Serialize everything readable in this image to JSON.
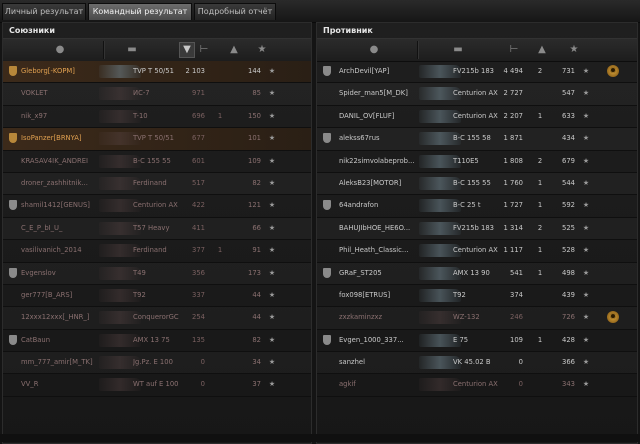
{
  "tabs": [
    {
      "label": "Личный результат",
      "active": false
    },
    {
      "label": "Командный результат",
      "active": true
    },
    {
      "label": "Подробный отчёт",
      "active": false
    }
  ],
  "allies": {
    "title": "Союзники",
    "rows": [
      {
        "name": "Gleborg[-KOPM]",
        "tank": "TVP T 50/51",
        "dmg": "2 103",
        "kills": "",
        "pts": "144",
        "hl": true,
        "dead": false
      },
      {
        "name": "VOKLET",
        "tank": "ИС-7",
        "dmg": "971",
        "kills": "",
        "pts": "85",
        "hl": false,
        "dead": true
      },
      {
        "name": "nik_x97",
        "tank": "T-10",
        "dmg": "696",
        "kills": "1",
        "pts": "150",
        "hl": false,
        "dead": true
      },
      {
        "name": "IsoPanzer[BRNYA]",
        "tank": "TVP T 50/51",
        "dmg": "677",
        "kills": "",
        "pts": "101",
        "hl": true,
        "dead": true
      },
      {
        "name": "KRASAV4IK_ANDREI",
        "tank": "B-C 155 55",
        "dmg": "601",
        "kills": "",
        "pts": "109",
        "hl": false,
        "dead": true
      },
      {
        "name": "droner_zashhitnik...",
        "tank": "Ferdinand",
        "dmg": "517",
        "kills": "",
        "pts": "82",
        "hl": false,
        "dead": true
      },
      {
        "name": "shamil1412[GENUS]",
        "tank": "Centurion AX",
        "dmg": "422",
        "kills": "",
        "pts": "121",
        "hl": false,
        "dead": true
      },
      {
        "name": "C_E_P_bI_U_",
        "tank": "T57 Heavy",
        "dmg": "411",
        "kills": "",
        "pts": "66",
        "hl": false,
        "dead": true
      },
      {
        "name": "vasilivanich_2014",
        "tank": "Ferdinand",
        "dmg": "377",
        "kills": "1",
        "pts": "91",
        "hl": false,
        "dead": true
      },
      {
        "name": "Evgenslov",
        "tank": "T49",
        "dmg": "356",
        "kills": "",
        "pts": "173",
        "hl": false,
        "dead": true
      },
      {
        "name": "ger777[B_ARS]",
        "tank": "T92",
        "dmg": "337",
        "kills": "",
        "pts": "44",
        "hl": false,
        "dead": true
      },
      {
        "name": "12xxx12xxx[_HNR_]",
        "tank": "ConquerorGC",
        "dmg": "254",
        "kills": "",
        "pts": "44",
        "hl": false,
        "dead": true
      },
      {
        "name": "CatBaun",
        "tank": "AMX 13 75",
        "dmg": "135",
        "kills": "",
        "pts": "82",
        "hl": false,
        "dead": true
      },
      {
        "name": "mm_777_amir[M_TK]",
        "tank": "Jg.Pz. E 100",
        "dmg": "0",
        "kills": "",
        "pts": "34",
        "hl": false,
        "dead": true
      },
      {
        "name": "VV_R",
        "tank": "WT auf E 100",
        "dmg": "0",
        "kills": "",
        "pts": "37",
        "hl": false,
        "dead": true
      }
    ]
  },
  "enemies": {
    "title": "Противник",
    "rows": [
      {
        "name": "ArchDevil[YAP]",
        "tank": "FV215b 183",
        "dmg": "4 494",
        "kills": "2",
        "pts": "731",
        "badge": true,
        "dead": false
      },
      {
        "name": "Spider_man5[M_DK]",
        "tank": "Centurion AX",
        "dmg": "2 727",
        "kills": "",
        "pts": "547",
        "badge": false,
        "dead": false
      },
      {
        "name": "DANIL_OV[FLUF]",
        "tank": "Centurion AX",
        "dmg": "2 207",
        "kills": "1",
        "pts": "633",
        "badge": false,
        "dead": false
      },
      {
        "name": "alekss67rus",
        "tank": "B-C 155 58",
        "dmg": "1 871",
        "kills": "",
        "pts": "434",
        "badge": false,
        "dead": false
      },
      {
        "name": "nik22simvolabeprob...",
        "tank": "T110E5",
        "dmg": "1 808",
        "kills": "2",
        "pts": "679",
        "badge": false,
        "dead": false
      },
      {
        "name": "AleksB23[MOTOR]",
        "tank": "B-C 155 55",
        "dmg": "1 760",
        "kills": "1",
        "pts": "544",
        "badge": false,
        "dead": false
      },
      {
        "name": "64andrafon",
        "tank": "B-C 25 t",
        "dmg": "1 727",
        "kills": "1",
        "pts": "592",
        "badge": false,
        "dead": false
      },
      {
        "name": "BAHUJIbHOE_HE6O...",
        "tank": "FV215b 183",
        "dmg": "1 314",
        "kills": "2",
        "pts": "525",
        "badge": false,
        "dead": false
      },
      {
        "name": "Phil_Heath_Classic...",
        "tank": "Centurion AX",
        "dmg": "1 117",
        "kills": "1",
        "pts": "528",
        "badge": false,
        "dead": false
      },
      {
        "name": "GRaF_ST205",
        "tank": "AMX 13 90",
        "dmg": "541",
        "kills": "1",
        "pts": "498",
        "badge": false,
        "dead": false
      },
      {
        "name": "fox098[ETRUS]",
        "tank": "T92",
        "dmg": "374",
        "kills": "",
        "pts": "439",
        "badge": false,
        "dead": false
      },
      {
        "name": "zxzkaminzxz",
        "tank": "WZ-132",
        "dmg": "246",
        "kills": "",
        "pts": "726",
        "badge": true,
        "dead": true
      },
      {
        "name": "Evgen_1000_337...",
        "tank": "E 75",
        "dmg": "109",
        "kills": "1",
        "pts": "428",
        "badge": false,
        "dead": false
      },
      {
        "name": "sanzhel",
        "tank": "VK 45.02 B",
        "dmg": "0",
        "kills": "",
        "pts": "366",
        "badge": false,
        "dead": false
      },
      {
        "name": "agkif",
        "tank": "Centurion AX",
        "dmg": "0",
        "kills": "",
        "pts": "343",
        "badge": false,
        "dead": true
      }
    ]
  },
  "icons": {
    "platoon": "user-icon",
    "tank": "tank-icon",
    "damage": "damage-icon",
    "kills": "kills-icon",
    "points": "star-icon",
    "badge": "medal-icon"
  }
}
